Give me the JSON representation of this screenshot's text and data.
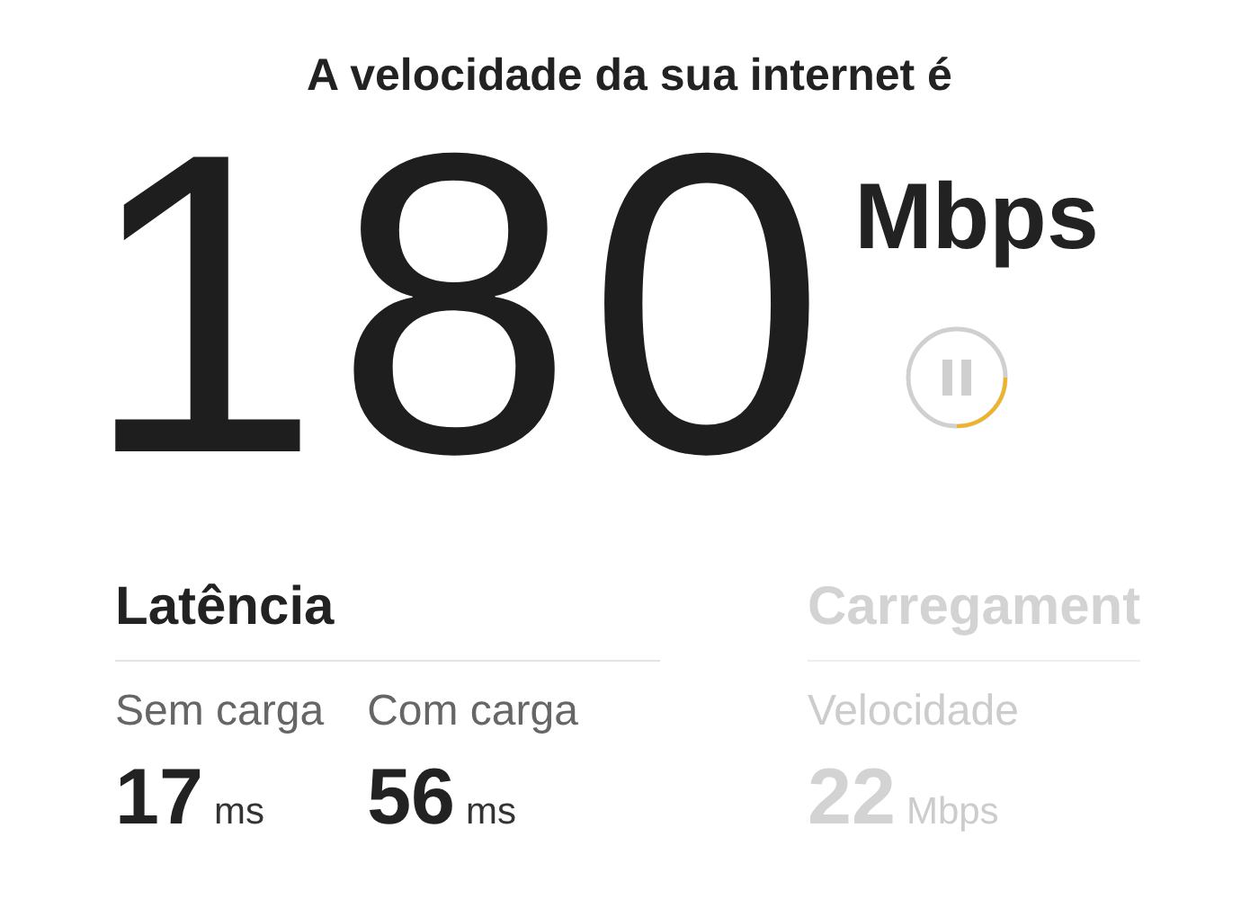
{
  "title": "A velocidade da sua internet é",
  "speed": {
    "value": "180",
    "unit": "Mbps"
  },
  "pause_button": {
    "progress_ring": true
  },
  "groups": [
    {
      "heading": "Latência",
      "active": true,
      "metrics": [
        {
          "label": "Sem carga",
          "value": "17",
          "unit": "ms"
        },
        {
          "label": "Com carga",
          "value": "56",
          "unit": "ms"
        }
      ]
    },
    {
      "heading": "Carregament",
      "active": false,
      "metrics": [
        {
          "label": "Velocidade",
          "value": "22",
          "unit": "Mbps"
        }
      ]
    }
  ]
}
